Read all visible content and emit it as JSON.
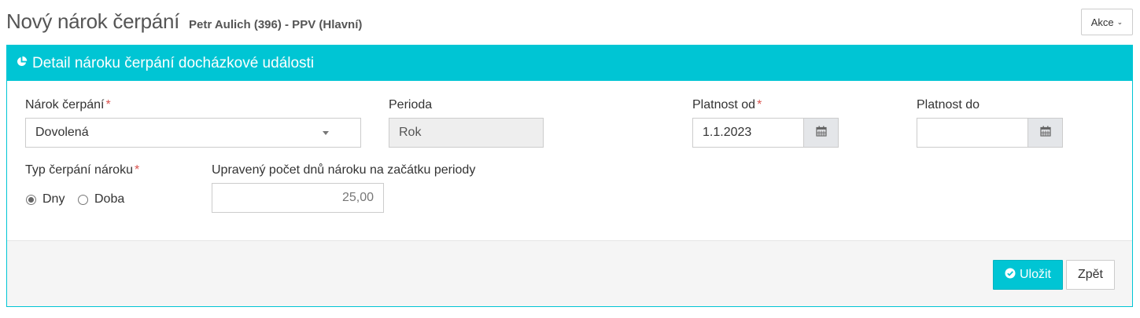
{
  "header": {
    "title": "Nový nárok čerpání",
    "subtitle": "Petr Aulich (396) - PPV (Hlavní)",
    "actions_label": "Akce",
    "actions_icon": "chevron-down-icon"
  },
  "panel": {
    "icon": "pie-chart-icon",
    "title": "Detail nároku čerpání docházkové události",
    "accent_color": "#00c5d4"
  },
  "form": {
    "narok": {
      "label": "Nárok čerpání",
      "required_mark": "*",
      "value": "Dovolená"
    },
    "perioda": {
      "label": "Perioda",
      "value": "Rok"
    },
    "platnost_od": {
      "label": "Platnost od",
      "required_mark": "*",
      "value": "1.1.2023"
    },
    "platnost_do": {
      "label": "Platnost do",
      "value": ""
    },
    "typ": {
      "label": "Typ čerpání nároku",
      "required_mark": "*",
      "options": [
        {
          "label": "Dny",
          "selected": true
        },
        {
          "label": "Doba",
          "selected": false
        }
      ]
    },
    "upraveny_pocet": {
      "label": "Upravený počet dnů nároku na začátku periody",
      "value": "25,00"
    }
  },
  "footer": {
    "save_label": "Uložit",
    "back_label": "Zpět"
  }
}
